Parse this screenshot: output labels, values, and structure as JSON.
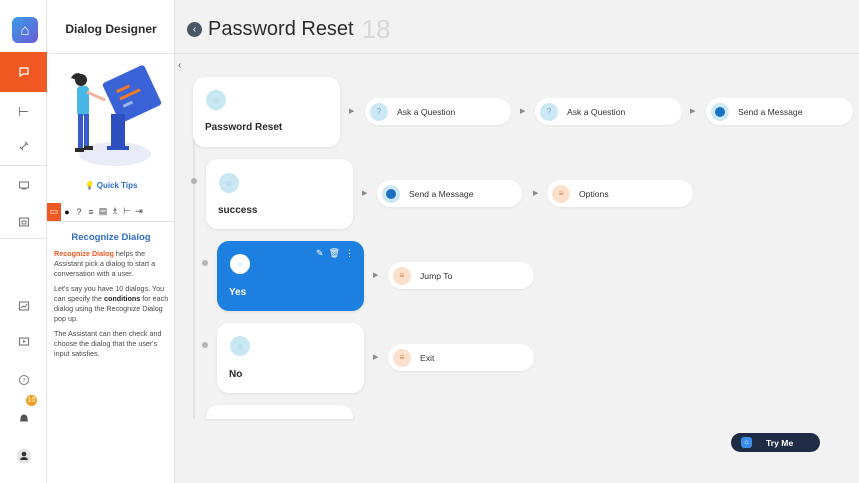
{
  "app": {
    "sidebar_title": "Dialog Designer"
  },
  "header": {
    "title": "Password Reset",
    "count": "18"
  },
  "quick_tips": {
    "label": "Quick Tips"
  },
  "recognize": {
    "title": "Recognize Dialog",
    "p1_hl": "Recognize Dialog",
    "p1_rest": " helps the Assistant pick a dialog to start a conversation with a user.",
    "p2_a": "Let's say you have 10 dialogs. You can specify the ",
    "p2_b": "conditions",
    "p2_c": " for each dialog using the Recognize Dialog pop up.",
    "p3": "The Assistant can then check and choose the dialog that the user's input satisfies."
  },
  "notifications": {
    "count": "10"
  },
  "cards": [
    {
      "label": "Password Reset"
    },
    {
      "label": "success"
    },
    {
      "label": "Yes"
    },
    {
      "label": "No"
    }
  ],
  "row1": [
    "Ask a Question",
    "Ask a Question",
    "Send a Message"
  ],
  "row2": [
    "Send a Message",
    "Options"
  ],
  "row3": [
    "Jump To"
  ],
  "row4": [
    "Exit"
  ],
  "try_me": "Try Me",
  "colors": {
    "accent": "#f05a22",
    "selected": "#1d7fe0",
    "brand": "#2e6ec6"
  }
}
